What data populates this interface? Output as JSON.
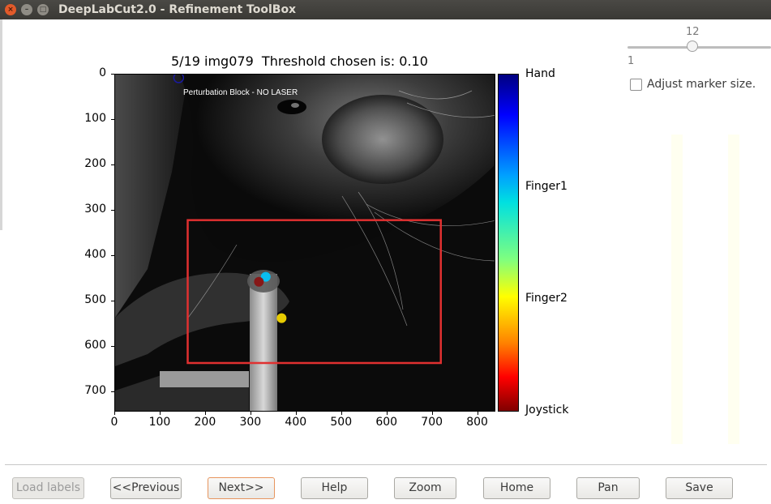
{
  "window": {
    "title": "DeepLabCut2.0 - Refinement ToolBox",
    "close_glyph": "×",
    "min_glyph": "–",
    "max_glyph": "□"
  },
  "plot": {
    "title": "5/19 img079  Threshold chosen is: 0.10",
    "overlay_text": "Perturbation Block - NO LASER",
    "yticks": [
      "0",
      "100",
      "200",
      "300",
      "400",
      "500",
      "600",
      "700"
    ],
    "xticks": [
      "0",
      "100",
      "200",
      "300",
      "400",
      "500",
      "600",
      "700",
      "800"
    ]
  },
  "colorbar": {
    "labels": [
      "Hand",
      "Finger1",
      "Finger2",
      "Joystick"
    ],
    "colors": [
      "#000080",
      "#00c8ff",
      "#ffee00",
      "#800000"
    ]
  },
  "markers": [
    {
      "name": "Hand",
      "x": 140,
      "y": 7,
      "color": "#1a1aa0"
    },
    {
      "name": "Finger1",
      "x": 332,
      "y": 446,
      "color": "#00c8ff"
    },
    {
      "name": "Finger2",
      "x": 367,
      "y": 537,
      "color": "#ffe000"
    },
    {
      "name": "Joystick",
      "x": 317,
      "y": 457,
      "color": "#8b1010"
    }
  ],
  "selection_box": {
    "x0": 160,
    "y0": 321,
    "x1": 718,
    "y1": 636,
    "color": "#e03030"
  },
  "marker_slider": {
    "value": "12",
    "min_label": "1"
  },
  "adjust_marker": {
    "label": "Adjust marker size.",
    "checked": false
  },
  "buttons": {
    "load_labels": "Load labels",
    "previous": "<<Previous",
    "next": "Next>>",
    "help": "Help",
    "zoom": "Zoom",
    "home": "Home",
    "pan": "Pan",
    "save": "Save"
  }
}
